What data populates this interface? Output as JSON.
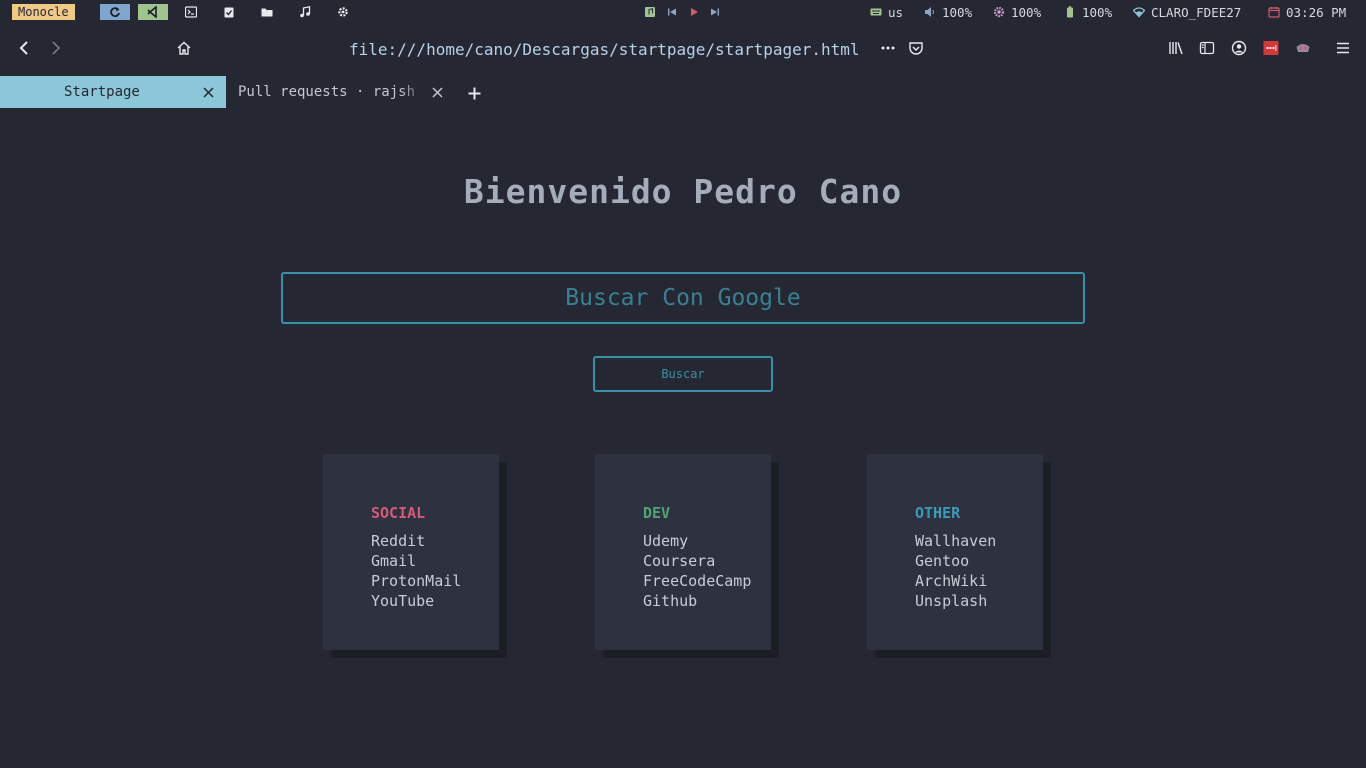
{
  "wmbar": {
    "layout_label": "Monocle",
    "workspaces": [
      {
        "icon": "refresh-icon",
        "color": "#7fa6cf"
      },
      {
        "icon": "vscode-icon",
        "color": "#9fc48f"
      },
      {
        "icon": "terminal-icon",
        "color": ""
      },
      {
        "icon": "clipboard-check-icon",
        "color": ""
      },
      {
        "icon": "folder-icon",
        "color": ""
      },
      {
        "icon": "music-icon",
        "color": ""
      },
      {
        "icon": "gear-icon",
        "color": ""
      }
    ],
    "status": {
      "keyboard": "us",
      "volume": "100%",
      "brightness": "100%",
      "battery": "100%",
      "wifi": "CLARO_FDEE27",
      "clock": "03:26 PM"
    },
    "accent_colors": {
      "brightness": "#d09acb",
      "wifi": "#8cc6d8",
      "calendar": "#d35a6a",
      "battery": "#9fc48f",
      "play": "#d35a6a",
      "music": "#9fc48f"
    }
  },
  "navbar": {
    "url": "file:///home/cano/Descargas/startpage/startpager.html"
  },
  "tabs": [
    {
      "label": "Startpage",
      "active": true
    },
    {
      "label": "Pull requests · rajsh",
      "active": false
    }
  ],
  "page": {
    "welcome": "Bienvenido Pedro Cano",
    "search_placeholder": "Buscar Con Google",
    "search_button": "Buscar",
    "cards": [
      {
        "heading": "SOCIAL",
        "color": "#d35a7a",
        "links": [
          "Reddit",
          "Gmail",
          "ProtonMail",
          "YouTube"
        ]
      },
      {
        "heading": "DEV",
        "color": "#4ea476",
        "links": [
          "Udemy",
          "Coursera",
          "FreeCodeCamp",
          "Github"
        ]
      },
      {
        "heading": "OTHER",
        "color": "#3a9ab8",
        "links": [
          "Wallhaven",
          "Gentoo",
          "ArchWiki",
          "Unsplash"
        ]
      }
    ]
  }
}
